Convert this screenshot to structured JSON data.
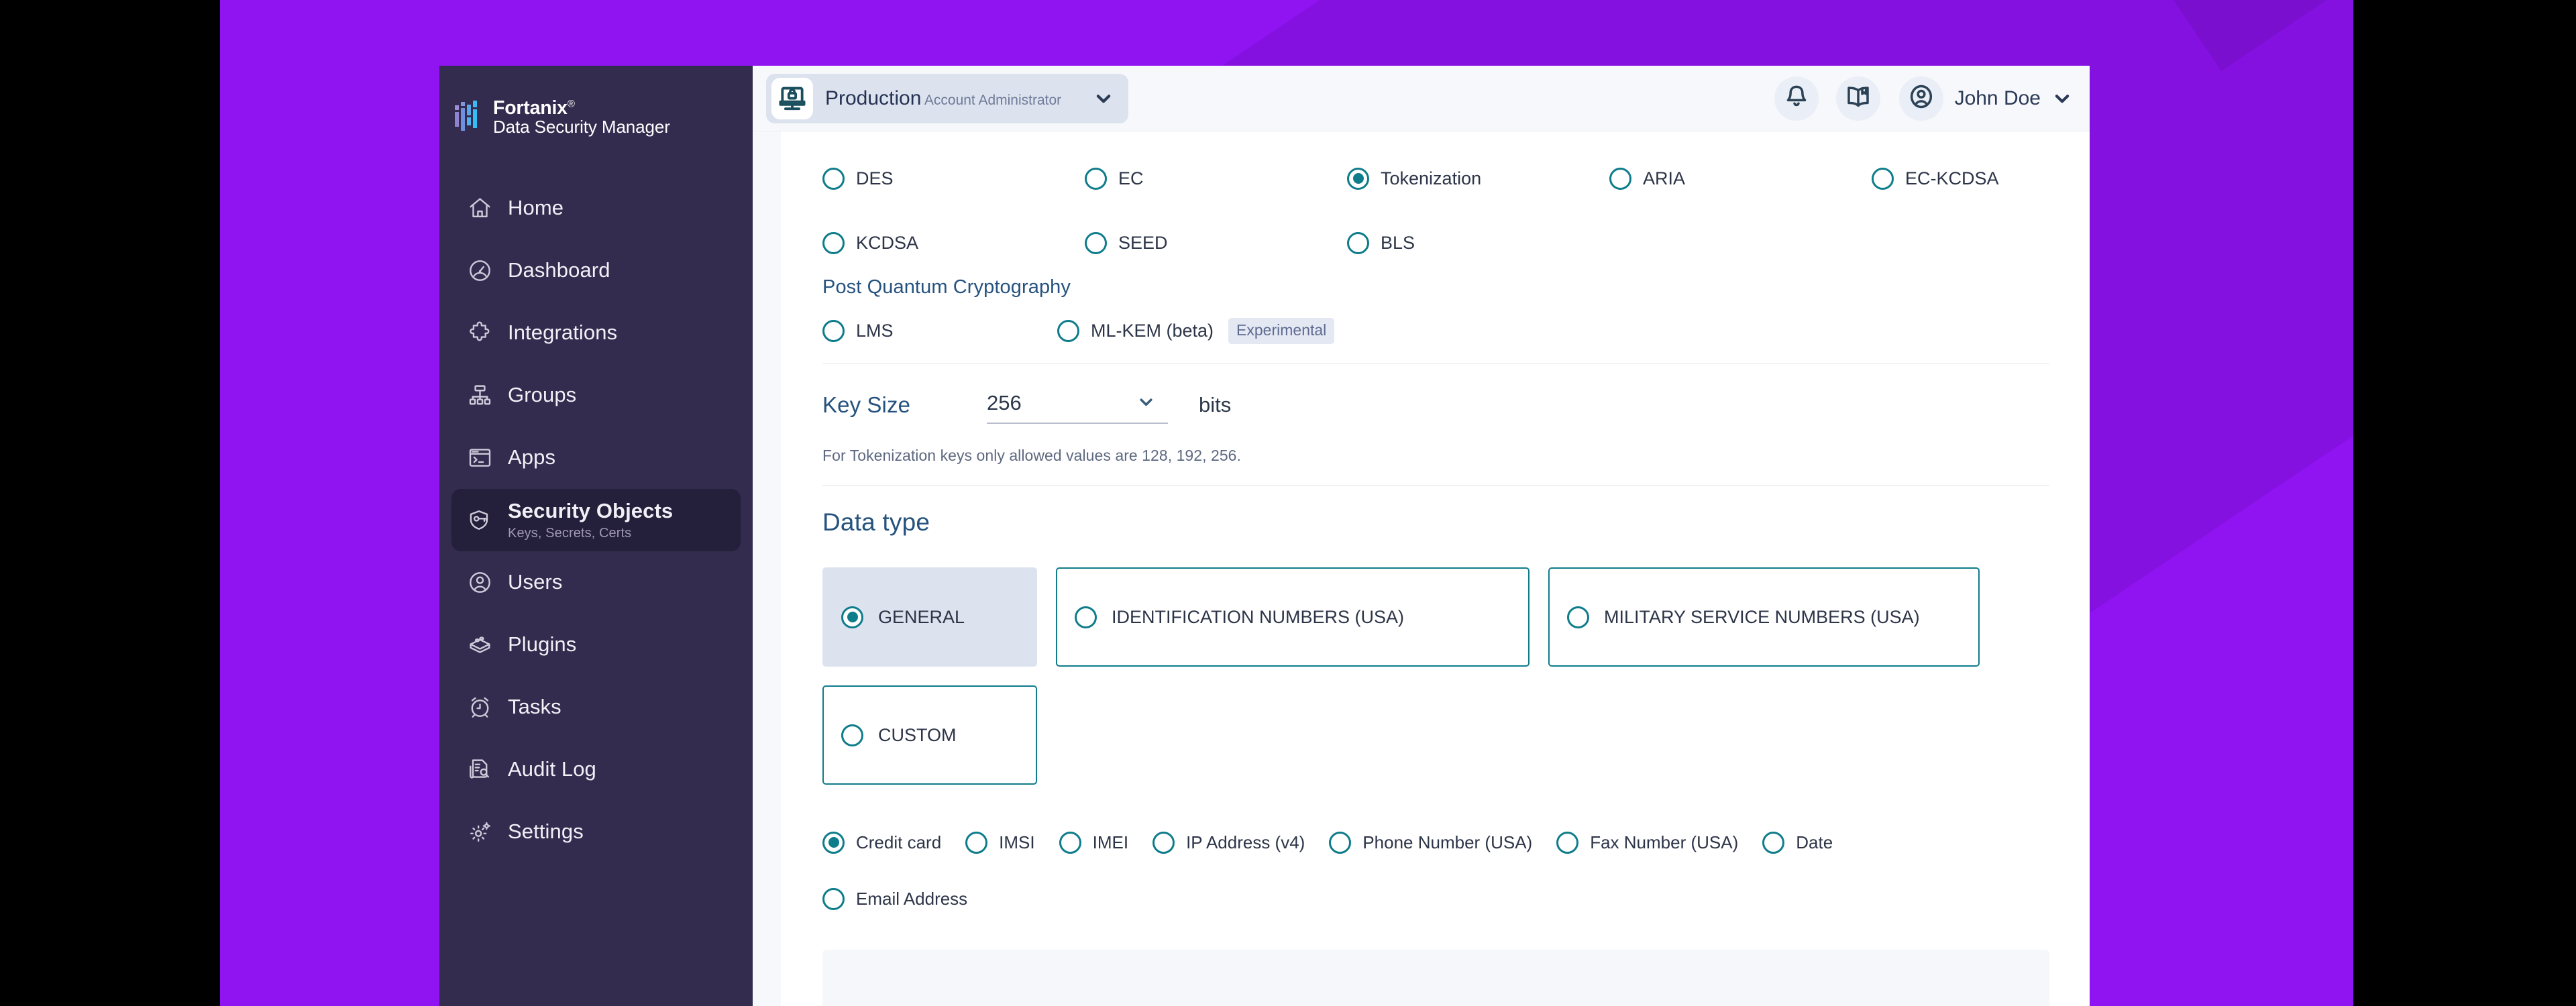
{
  "brand": {
    "name": "Fortanix",
    "registered": "®",
    "product": "Data Security Manager",
    "logo_icon": "fortanix-bars-logo"
  },
  "colors": {
    "desktop_purple": "#9013f2",
    "sidebar": "#332c4e",
    "accent_teal": "#0e7c8b",
    "heading_blue": "#25527e",
    "selected_card_bg": "#dde3ee"
  },
  "sidebar": {
    "items": [
      {
        "label": "Home",
        "icon": "home-icon",
        "sub": "",
        "active": false
      },
      {
        "label": "Dashboard",
        "icon": "gauge-icon",
        "sub": "",
        "active": false
      },
      {
        "label": "Integrations",
        "icon": "puzzle-piece-icon",
        "sub": "",
        "active": false
      },
      {
        "label": "Groups",
        "icon": "org-chart-icon",
        "sub": "",
        "active": false
      },
      {
        "label": "Apps",
        "icon": "terminal-window-icon",
        "sub": "",
        "active": false
      },
      {
        "label": "Security Objects",
        "icon": "shield-key-icon",
        "sub": "Keys, Secrets, Certs",
        "active": true
      },
      {
        "label": "Users",
        "icon": "user-circle-icon",
        "sub": "",
        "active": false
      },
      {
        "label": "Plugins",
        "icon": "lego-brick-icon",
        "sub": "",
        "active": false
      },
      {
        "label": "Tasks",
        "icon": "alarm-clock-icon",
        "sub": "",
        "active": false
      },
      {
        "label": "Audit Log",
        "icon": "document-search-icon",
        "sub": "",
        "active": false
      },
      {
        "label": "Settings",
        "icon": "gear-icon",
        "sub": "",
        "active": false
      }
    ]
  },
  "header": {
    "account": {
      "name": "Production",
      "role": "Account Administrator",
      "icon": "laptop-lock-icon",
      "chevron": "chevron-down-icon"
    },
    "notifications_icon": "bell-icon",
    "docs_icon": "book-icon",
    "avatar_icon": "user-avatar-icon",
    "user_name": "John Doe",
    "user_chevron": "chevron-down-icon"
  },
  "main": {
    "algorithms": {
      "rows": [
        [
          {
            "label": "DES",
            "selected": false
          },
          {
            "label": "EC",
            "selected": false
          },
          {
            "label": "Tokenization",
            "selected": true
          },
          {
            "label": "ARIA",
            "selected": false
          },
          {
            "label": "EC-KCDSA",
            "selected": false
          }
        ],
        [
          {
            "label": "KCDSA",
            "selected": false
          },
          {
            "label": "SEED",
            "selected": false
          },
          {
            "label": "BLS",
            "selected": false
          }
        ]
      ]
    },
    "post_quantum": {
      "title": "Post Quantum Cryptography",
      "options": [
        {
          "label": "LMS",
          "selected": false,
          "badge": ""
        },
        {
          "label": "ML-KEM (beta)",
          "selected": false,
          "badge": "Experimental"
        }
      ]
    },
    "key_size": {
      "label": "Key Size",
      "value": "256",
      "units": "bits",
      "hint": "For Tokenization keys only allowed values are 128, 192, 256.",
      "chevron": "chevron-down-icon"
    },
    "data_type": {
      "title": "Data type",
      "cards": [
        {
          "label": "GENERAL",
          "selected": true
        },
        {
          "label": "IDENTIFICATION NUMBERS (USA)",
          "selected": false
        },
        {
          "label": "MILITARY SERVICE NUMBERS (USA)",
          "selected": false
        },
        {
          "label": "CUSTOM",
          "selected": false
        }
      ],
      "subtypes_row1": [
        {
          "label": "Credit card",
          "selected": true
        },
        {
          "label": "IMSI",
          "selected": false
        },
        {
          "label": "IMEI",
          "selected": false
        },
        {
          "label": "IP Address (v4)",
          "selected": false
        },
        {
          "label": "Phone Number (USA)",
          "selected": false
        },
        {
          "label": "Fax Number (USA)",
          "selected": false
        },
        {
          "label": "Date",
          "selected": false
        }
      ],
      "subtypes_row2": [
        {
          "label": "Email Address",
          "selected": false
        }
      ]
    }
  }
}
